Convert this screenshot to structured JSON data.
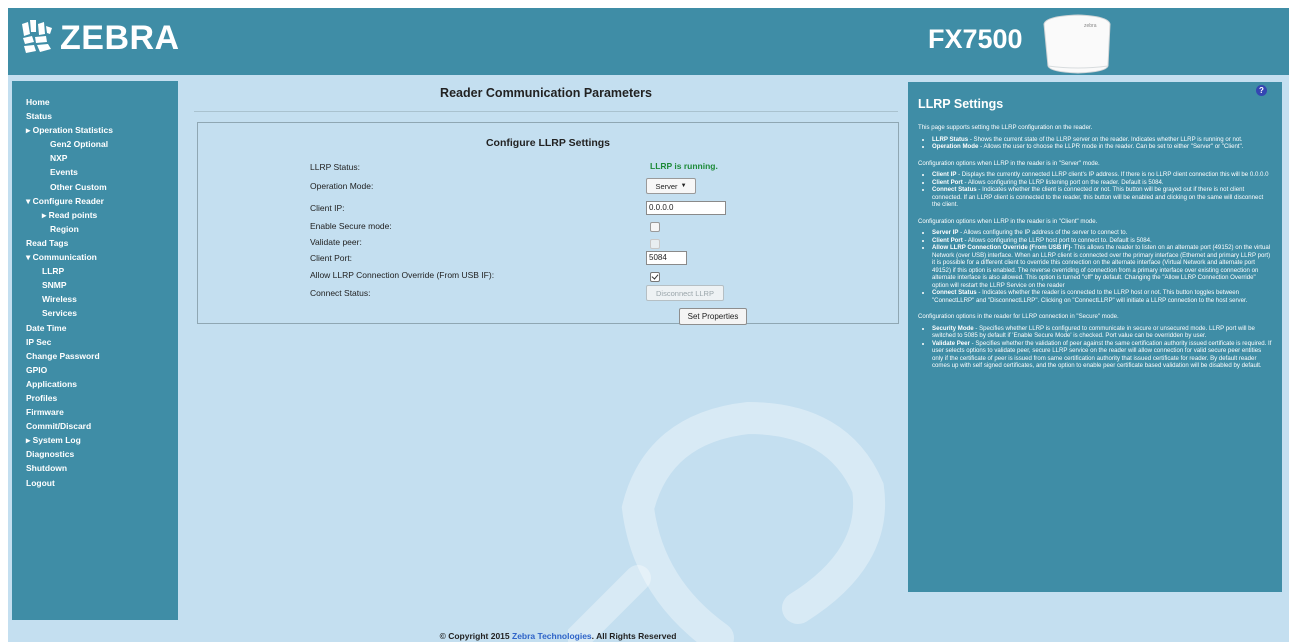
{
  "header": {
    "brand": "ZEBRA",
    "model": "FX7500",
    "device_label": "zebra"
  },
  "sidebar": {
    "items": [
      {
        "label": "Home",
        "level": 0
      },
      {
        "label": "Status",
        "level": 0
      },
      {
        "label": "▸ Operation Statistics",
        "level": 0
      },
      {
        "label": "Gen2 Optional",
        "level": 2
      },
      {
        "label": "NXP",
        "level": 2
      },
      {
        "label": "Events",
        "level": 2
      },
      {
        "label": "Other Custom",
        "level": 2
      },
      {
        "label": "▾ Configure Reader",
        "level": 0
      },
      {
        "label": "▸ Read points",
        "level": 1
      },
      {
        "label": "Region",
        "level": 2
      },
      {
        "label": "Read Tags",
        "level": 0
      },
      {
        "label": "▾ Communication",
        "level": 0
      },
      {
        "label": "LLRP",
        "level": 1
      },
      {
        "label": "SNMP",
        "level": 1
      },
      {
        "label": "Wireless",
        "level": 1
      },
      {
        "label": "Services",
        "level": 1
      },
      {
        "label": "Date Time",
        "level": 0
      },
      {
        "label": "IP Sec",
        "level": 0
      },
      {
        "label": "Change Password",
        "level": 0
      },
      {
        "label": "GPIO",
        "level": 0
      },
      {
        "label": "Applications",
        "level": 0
      },
      {
        "label": "Profiles",
        "level": 0
      },
      {
        "label": "Firmware",
        "level": 0
      },
      {
        "label": "Commit/Discard",
        "level": 0
      },
      {
        "label": "▸ System Log",
        "level": 0
      },
      {
        "label": "Diagnostics",
        "level": 0
      },
      {
        "label": "Shutdown",
        "level": 0
      },
      {
        "label": "Logout",
        "level": 0
      }
    ]
  },
  "main": {
    "page_title": "Reader Communication Parameters",
    "box_title": "Configure LLRP Settings",
    "labels": {
      "llrp_status": "LLRP Status:",
      "operation_mode": "Operation Mode:",
      "client_ip": "Client IP:",
      "secure_mode": "Enable Secure mode:",
      "validate_peer": "Validate peer:",
      "client_port": "Client Port:",
      "override": "Allow LLRP Connection Override (From USB IF):",
      "connect_status": "Connect Status:"
    },
    "llrp_status_value": "LLRP is running.",
    "operation_mode_value": "Server",
    "client_ip_value": "0.0.0.0",
    "client_port_value": "5084",
    "enable_secure_mode": false,
    "validate_peer": false,
    "allow_override": true,
    "disconnect_button": "Disconnect LLRP",
    "set_properties_button": "Set Properties"
  },
  "help": {
    "title": "LLRP Settings",
    "icon": "?",
    "intro": "This page supports setting the LLRP configuration on the reader.",
    "list1": [
      {
        "term": "LLRP Status",
        "text": " - Shows the current state of the LLRP server on the reader. Indicates whether LLRP is running or not."
      },
      {
        "term": "Operation Mode",
        "text": " - Allows the user to choose the LLPR mode in the reader. Can be set to either \"Server\" or \"Client\"."
      }
    ],
    "server_heading": "Configuration options when LLRP in the reader is in \"Server\" mode.",
    "list2": [
      {
        "term": "Client IP",
        "text": " - Displays the currently connected LLRP client's IP address. If there is no LLRP client connection this will be 0.0.0.0"
      },
      {
        "term": "Client Port",
        "text": " - Allows configuring the LLRP listening port on the reader. Default is 5084."
      },
      {
        "term": "Connect Status",
        "text": " - Indicates whether the client is connected or not. This button will be grayed out if there is not client connected. If an LLRP client is connected to the reader, this button will be enabled and clicking on the same will disconnect the client."
      }
    ],
    "client_heading": "Configuration options when LLRP in the reader is in \"Client\" mode.",
    "list3": [
      {
        "term": "Server IP",
        "text": " - Allows configuring the IP address of the server to connect to."
      },
      {
        "term": "Client Port",
        "text": " - Allows configuring the LLRP host port to connect to. Default is 5084."
      },
      {
        "term": "Allow LLRP Connection Override (From USB IF)",
        "text": "- This allows the reader to listen on an alternate port (49152) on the virtual Network (over USB) interface. When an LLRP client is connected over the primary interface (Ethernet and primary LLRP port) it is possible for a different client to override this connection on the alternate interface (Virtual Network and alternate port 49152) if this option is enabled. The reverse overriding of connection from a primary interface over existing connection on alternate interface is also allowed. This option is turned \"off\" by default. Changing the \"Allow LLRP Connection Override\" option will restart the LLRP Service on the reader"
      },
      {
        "term": "Connect Status",
        "text": " - Indicates whether the reader is connected to the LLRP host or not. This button toggles between \"ConnectLLRP\" and \"DisconnectLLRP\". Clicking on \"ConnectLLRP\" will initiate a LLRP connection to the host server."
      }
    ],
    "secure_heading": "Configuration options in the reader for LLRP connection in \"Secure\" mode.",
    "list4": [
      {
        "term": "Security Mode",
        "text": " - Specifies whether LLRP is configured to communicate in secure or unsecured mode. LLRP port will be switched to 5085 by default if 'Enable Secure Mode' is checked. Port value can be overridden by user."
      },
      {
        "term": "Validate Peer",
        "text": " - Specifies whether the validation of peer against the same certification authority issued certificate is required. If user selects options to validate peer, secure LLRP service on the reader will allow connection for valid secure peer entities only if the certificate of peer is issued from same certification authority that issued certificate for reader. By default reader comes up with self signed certificates, and the option to enable peer certificate based validation will be disabled by default."
      }
    ]
  },
  "footer": {
    "prefix": "© Copyright 2015 ",
    "link": "Zebra Technologies",
    "suffix": ". All Rights Reserved"
  },
  "colors": {
    "frame_bg": "#c4dff0",
    "panel_bg": "#3f8da6",
    "status_green": "#1d8a38"
  }
}
